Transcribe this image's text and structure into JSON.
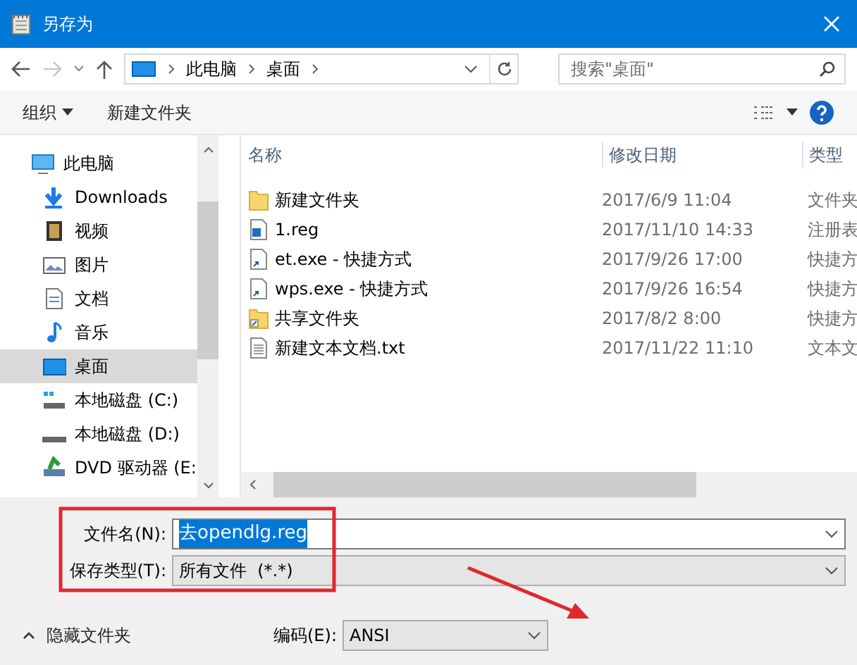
{
  "window": {
    "title": "另存为"
  },
  "address": {
    "crumbs": [
      "此电脑",
      "桌面"
    ]
  },
  "search": {
    "placeholder": "搜索\"桌面\""
  },
  "toolbar": {
    "organize": "组织",
    "new_folder": "新建文件夹"
  },
  "sidebar": {
    "items": [
      {
        "label": "此电脑",
        "kind": "pc",
        "selected": false
      },
      {
        "label": "Downloads",
        "kind": "download",
        "selected": false
      },
      {
        "label": "视频",
        "kind": "video",
        "selected": false
      },
      {
        "label": "图片",
        "kind": "picture",
        "selected": false
      },
      {
        "label": "文档",
        "kind": "doc",
        "selected": false
      },
      {
        "label": "音乐",
        "kind": "music",
        "selected": false
      },
      {
        "label": "桌面",
        "kind": "desktop",
        "selected": true
      },
      {
        "label": "本地磁盘 (C:)",
        "kind": "sysdisk",
        "selected": false
      },
      {
        "label": "本地磁盘 (D:)",
        "kind": "disk",
        "selected": false
      },
      {
        "label": "DVD 驱动器 (E:",
        "kind": "dvd",
        "selected": false
      }
    ]
  },
  "table": {
    "columns": [
      "名称",
      "修改日期",
      "类型"
    ],
    "rows": [
      {
        "kind": "folder",
        "name": "新建文件夹",
        "date": "2017/6/9 11:04",
        "type": "文件夹"
      },
      {
        "kind": "reg",
        "name": "1.reg",
        "date": "2017/11/10 14:33",
        "type": "注册表"
      },
      {
        "kind": "shortcut",
        "name": "et.exe - 快捷方式",
        "date": "2017/9/26 17:00",
        "type": "快捷方"
      },
      {
        "kind": "shortcut",
        "name": "wps.exe - 快捷方式",
        "date": "2017/9/26 16:54",
        "type": "快捷方"
      },
      {
        "kind": "folder-shortcut",
        "name": "共享文件夹",
        "date": "2017/8/2 8:00",
        "type": "快捷方"
      },
      {
        "kind": "text",
        "name": "新建文本文档.txt",
        "date": "2017/11/22 11:10",
        "type": "文本文"
      }
    ]
  },
  "form": {
    "filename_label": "文件名(N):",
    "filename": "去opendlg.reg",
    "filename_selected": true,
    "type_label": "保存类型(T):",
    "type": "所有文件  (*.*)"
  },
  "footer": {
    "hide_folders": "隐藏文件夹",
    "encoding_label": "编码(E):",
    "encoding": "ANSI"
  },
  "annotations": {
    "frame": true,
    "arrow": true
  }
}
